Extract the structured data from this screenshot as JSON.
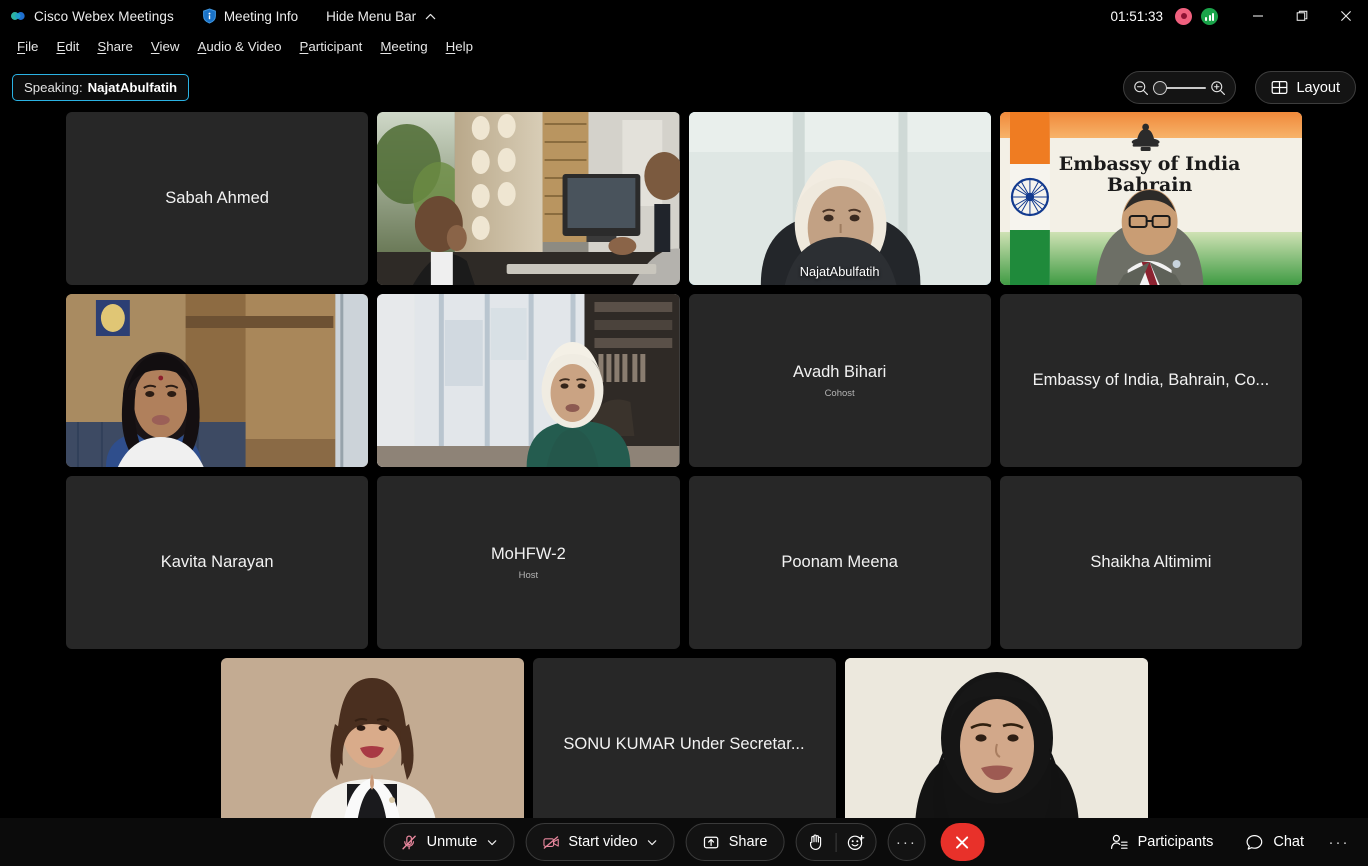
{
  "window": {
    "app_title": "Cisco Webex Meetings",
    "meeting_info_label": "Meeting Info",
    "hide_menu_bar_label": "Hide Menu Bar",
    "timer": "01:51:33",
    "minimize_label": "Minimize",
    "maximize_label": "Restore",
    "close_label": "Close",
    "recording_indicator": "Recording",
    "network_indicator": "Network quality"
  },
  "menubar": {
    "items": [
      {
        "accel": "F",
        "rest": "ile"
      },
      {
        "accel": "E",
        "rest": "dit"
      },
      {
        "accel": "S",
        "rest": "hare"
      },
      {
        "accel": "V",
        "rest": "iew"
      },
      {
        "accel": "A",
        "rest": "udio & Video"
      },
      {
        "accel": "P",
        "rest": "articipant"
      },
      {
        "accel": "M",
        "rest": "eeting"
      },
      {
        "accel": "H",
        "rest": "elp"
      }
    ]
  },
  "speaking": {
    "label": "Speaking:",
    "name": "NajatAbulfatih"
  },
  "controls": {
    "zoom_out_label": "Zoom out",
    "zoom_in_label": "Zoom in",
    "zoom_slider_value": 0,
    "layout_label": "Layout"
  },
  "grid": {
    "rows": [
      [
        {
          "name": "Sabah Ahmed",
          "role": "",
          "video": false,
          "active": false,
          "overlay": ""
        },
        {
          "name": "",
          "role": "",
          "video": true,
          "scene": "office-two-men",
          "active": false,
          "overlay": ""
        },
        {
          "name": "",
          "role": "",
          "video": true,
          "scene": "najat",
          "active": true,
          "overlay": "NajatAbulfatih"
        },
        {
          "name": "",
          "role": "",
          "video": true,
          "scene": "embassy",
          "active": false,
          "overlay": ""
        }
      ],
      [
        {
          "name": "",
          "role": "",
          "video": true,
          "scene": "woman-wood-office",
          "active": false,
          "overlay": ""
        },
        {
          "name": "",
          "role": "",
          "video": true,
          "scene": "woman-window-office",
          "active": false,
          "overlay": ""
        },
        {
          "name": "Avadh Bihari",
          "role": "Cohost",
          "video": false,
          "active": false,
          "overlay": ""
        },
        {
          "name": "Embassy of India, Bahrain, Co...",
          "role": "",
          "video": false,
          "active": false,
          "overlay": ""
        }
      ],
      [
        {
          "name": "Kavita Narayan",
          "role": "",
          "video": false,
          "active": false,
          "overlay": ""
        },
        {
          "name": "MoHFW-2",
          "role": "Host",
          "video": false,
          "active": false,
          "overlay": ""
        },
        {
          "name": "Poonam Meena",
          "role": "",
          "video": false,
          "active": false,
          "overlay": ""
        },
        {
          "name": "Shaikha Altimimi",
          "role": "",
          "video": false,
          "active": false,
          "overlay": ""
        }
      ],
      [
        {
          "name": "",
          "role": "",
          "video": true,
          "scene": "portrait-beige",
          "active": false,
          "overlay": ""
        },
        {
          "name": "SONU KUMAR Under Secretar...",
          "role": "",
          "video": false,
          "active": false,
          "overlay": ""
        },
        {
          "name": "",
          "role": "",
          "video": true,
          "scene": "portrait-hijab",
          "active": false,
          "overlay": ""
        }
      ]
    ],
    "embassy_banner_line1": "Embassy of India",
    "embassy_banner_line2": "Bahrain"
  },
  "toolbar": {
    "unmute_label": "Unmute",
    "start_video_label": "Start video",
    "share_label": "Share",
    "raise_hand_label": "Raise hand",
    "reactions_label": "Reactions",
    "more_options_label": "More options",
    "leave_label": "Leave meeting",
    "participants_label": "Participants",
    "chat_label": "Chat",
    "more_panels_label": "More panel options"
  },
  "colors": {
    "accent_active_speaker": "#29b0e0",
    "leave_button": "#e8312a",
    "recording": "#f0607e",
    "network": "#1aa34a",
    "tile_background": "#272727",
    "toolbar_background": "#0b0b0b"
  }
}
